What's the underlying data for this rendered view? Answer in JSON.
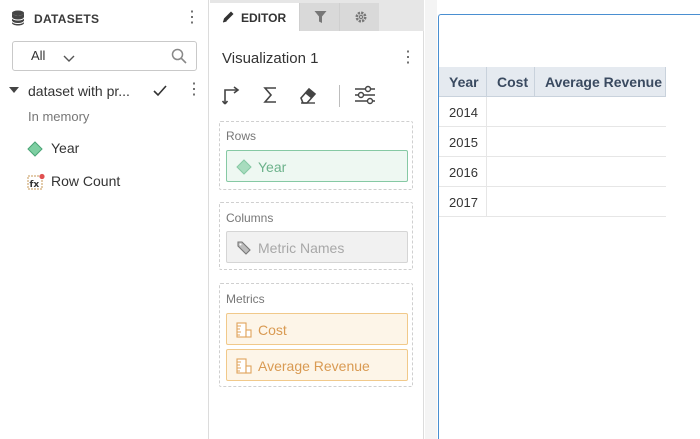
{
  "datasets_panel": {
    "title": "DATASETS",
    "filter_value": "All",
    "dataset": {
      "name": "dataset with pr...",
      "source": "In memory",
      "fields": [
        {
          "name": "Year",
          "kind": "attribute"
        },
        {
          "name": "Row Count",
          "kind": "derived-metric"
        }
      ]
    }
  },
  "editor": {
    "tabs": {
      "editor_label": "EDITOR"
    },
    "viz_title": "Visualization 1",
    "zones": {
      "rows": {
        "label": "Rows",
        "items": [
          "Year"
        ]
      },
      "columns": {
        "label": "Columns",
        "items": [
          "Metric Names"
        ]
      },
      "metrics": {
        "label": "Metrics",
        "items": [
          "Cost",
          "Average Revenue"
        ]
      }
    }
  },
  "grid": {
    "headers": [
      "Year",
      "Cost",
      "Average Revenue"
    ],
    "rows": [
      [
        "2014"
      ],
      [
        "2015"
      ],
      [
        "2016"
      ],
      [
        "2017"
      ]
    ]
  },
  "colors": {
    "attribute": "#6cb28b",
    "metric": "#d99a52",
    "header_bg": "#e5eaf0",
    "viz_border": "#4a8fd1"
  }
}
